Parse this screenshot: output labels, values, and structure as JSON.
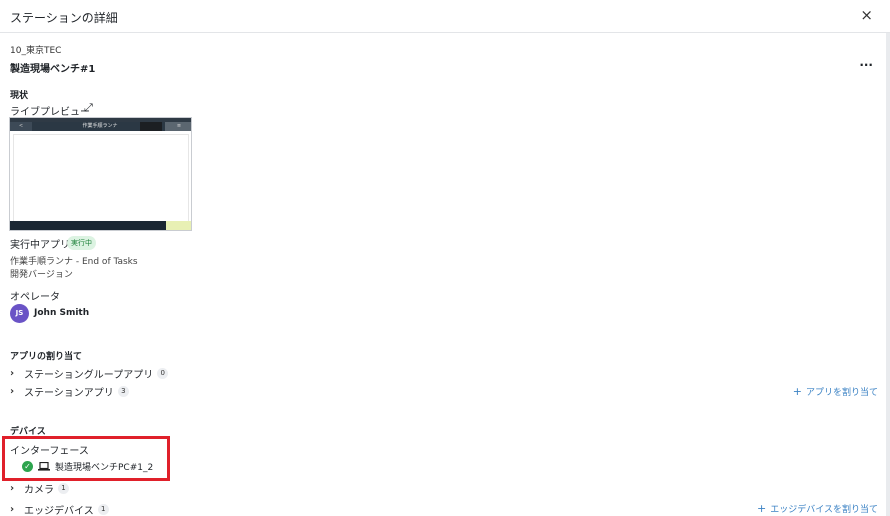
{
  "header": {
    "title": "ステーションの詳細",
    "close_icon": "×"
  },
  "site": "10_東京TEC",
  "station_name": "製造現場ベンチ#1",
  "more_icon": "···",
  "status": {
    "heading": "現状",
    "live_preview_label": "ライブプレビュー",
    "expand_icon": "⤢",
    "preview": {
      "title": "作業手順ランナ"
    },
    "running_app_label": "実行中アプリ",
    "running_badge": "実行中",
    "app_line": "作業手順ランナ  -  End of Tasks",
    "app_version": "開発バージョン",
    "operator_label": "オペレータ",
    "operator_initials": "JS",
    "operator_name": "John Smith"
  },
  "assignment": {
    "heading": "アプリの割り当て",
    "items": [
      {
        "label": "ステーショングループアプリ",
        "count": "0"
      },
      {
        "label": "ステーションアプリ",
        "count": "3"
      }
    ],
    "assign_link": "アプリを割り当て"
  },
  "devices": {
    "heading": "デバイス",
    "interface_label": "インターフェース",
    "interface_item": "製造現場ベンチPC#1_2",
    "items": [
      {
        "label": "カメラ",
        "count": "1"
      },
      {
        "label": "エッジデバイス",
        "count": "1"
      }
    ],
    "assign_link": "エッジデバイスを割り当て"
  },
  "colors": {
    "accent": "#3b82c4",
    "success": "#2da44e",
    "highlight": "#e0202a",
    "avatar": "#6a53c6"
  }
}
